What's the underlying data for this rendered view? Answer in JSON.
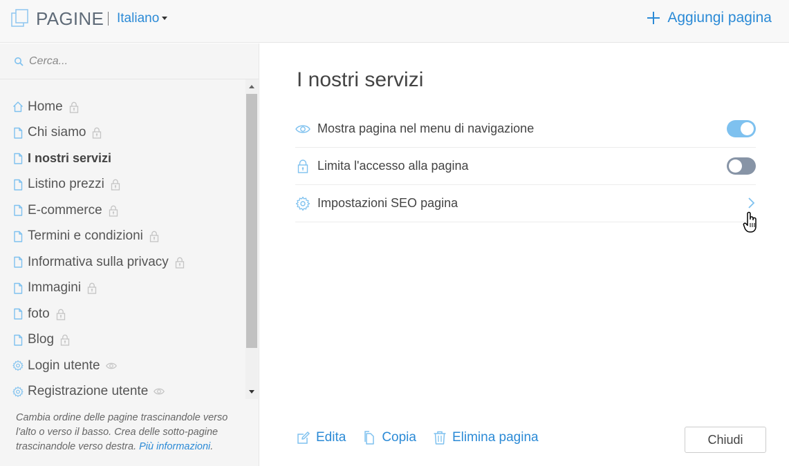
{
  "header": {
    "title": "PAGINE",
    "language": "Italiano",
    "add_page_label": "Aggiungi pagina"
  },
  "sidebar": {
    "search_placeholder": "Cerca...",
    "items": [
      {
        "label": "Home",
        "icon": "home-icon",
        "trail_icon": "lock-icon",
        "active": false
      },
      {
        "label": "Chi siamo",
        "icon": "page-icon",
        "trail_icon": "lock-icon",
        "active": false
      },
      {
        "label": "I nostri servizi",
        "icon": "page-icon",
        "trail_icon": "",
        "active": true
      },
      {
        "label": "Listino prezzi",
        "icon": "page-icon",
        "trail_icon": "lock-icon",
        "active": false
      },
      {
        "label": "E-commerce",
        "icon": "page-icon",
        "trail_icon": "lock-icon",
        "active": false
      },
      {
        "label": "Termini e condizioni",
        "icon": "page-icon",
        "trail_icon": "lock-icon",
        "active": false
      },
      {
        "label": "Informativa sulla privacy",
        "icon": "page-icon",
        "trail_icon": "lock-icon",
        "active": false
      },
      {
        "label": "Immagini",
        "icon": "page-icon",
        "trail_icon": "lock-icon",
        "active": false
      },
      {
        "label": "foto",
        "icon": "page-icon",
        "trail_icon": "lock-icon",
        "active": false
      },
      {
        "label": "Blog",
        "icon": "page-icon",
        "trail_icon": "lock-icon",
        "active": false
      },
      {
        "label": "Login utente",
        "icon": "gear-icon",
        "trail_icon": "eye-icon",
        "active": false
      },
      {
        "label": "Registrazione utente",
        "icon": "gear-icon",
        "trail_icon": "eye-icon",
        "active": false
      }
    ],
    "help_text": "Cambia ordine delle pagine trascinandole verso l'alto o verso il basso. Crea delle sotto-pagine trascinandole verso destra.",
    "help_link": "Più informazioni",
    "help_end": "."
  },
  "main": {
    "title": "I nostri servizi",
    "options": [
      {
        "label": "Mostra pagina nel menu di navigazione",
        "icon": "eye-icon",
        "control": "toggle",
        "state": true
      },
      {
        "label": "Limita l'accesso alla pagina",
        "icon": "lock-icon",
        "control": "toggle",
        "state": false
      },
      {
        "label": "Impostazioni SEO pagina",
        "icon": "gear-icon",
        "control": "chevron-right-icon"
      }
    ],
    "actions": {
      "edit": "Edita",
      "copy": "Copia",
      "delete": "Elimina pagina"
    },
    "close_label": "Chiudi"
  },
  "colors": {
    "accent": "#2b8ad6",
    "icon_blue": "#7ec1ef",
    "toggle_on": "#7ec1ef",
    "toggle_off": "#8794a6"
  }
}
